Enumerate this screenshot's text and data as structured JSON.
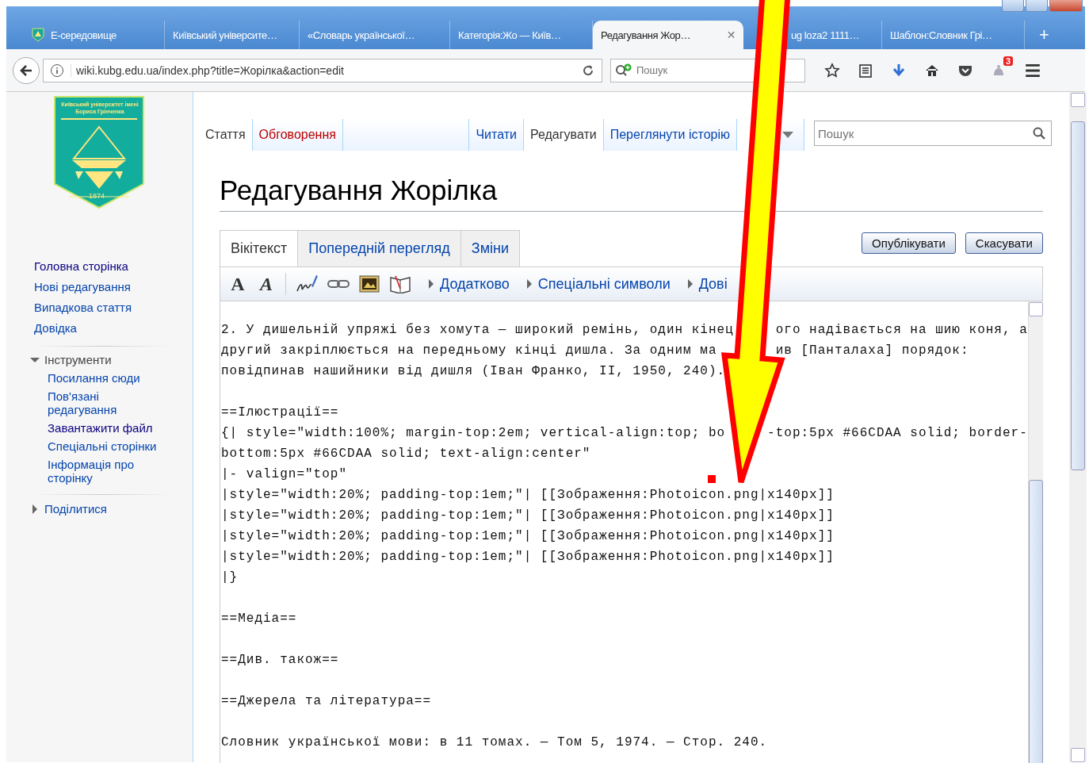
{
  "browser": {
    "tabs": [
      {
        "label": "Е-середовище",
        "selected": false
      },
      {
        "label": "Київський університе…",
        "selected": false
      },
      {
        "label": "«Словарь української…",
        "selected": false
      },
      {
        "label": "Категорія:Жо — Київ…",
        "selected": false
      },
      {
        "label": "Редагування Жор…",
        "selected": true
      },
      {
        "label": "ug loza2 1111…",
        "selected": false
      },
      {
        "label": "Шаблон:Словник Грі…",
        "selected": false
      }
    ],
    "close_glyph": "✕",
    "new_tab": "+",
    "address": "wiki.kubg.edu.ua/index.php?title=Жорілка&action=edit",
    "search_placeholder": "Пошук",
    "notification_count": "3"
  },
  "wiki": {
    "logo": {
      "caption": "Київський університет імені Бориса Грінченка",
      "year": "1874"
    },
    "nav": [
      {
        "label": "Головна сторінка",
        "visited": true
      },
      {
        "label": "Нові редагування",
        "visited": false
      },
      {
        "label": "Випадкова стаття",
        "visited": false
      },
      {
        "label": "Довідка",
        "visited": false
      }
    ],
    "tools": {
      "title": "Інструменти",
      "expanded": true,
      "items": [
        {
          "label": "Посилання сюди",
          "visited": false
        },
        {
          "label": "Пов'язані редагування",
          "visited": false
        },
        {
          "label": "Завантажити файл",
          "visited": true
        },
        {
          "label": "Спеціальні сторінки",
          "visited": false
        },
        {
          "label": "Інформація про сторінку",
          "visited": false
        }
      ]
    },
    "share": {
      "title": "Поділитися",
      "expanded": false
    },
    "namespaces": [
      {
        "label": "Стаття",
        "selected": true,
        "missing": false
      },
      {
        "label": "Обговорення",
        "selected": false,
        "missing": true
      }
    ],
    "views": [
      {
        "label": "Читати",
        "selected": false
      },
      {
        "label": "Редагувати",
        "selected": true
      },
      {
        "label": "Переглянути історію",
        "selected": false
      }
    ],
    "search_placeholder": "Пошук",
    "heading": "Редагування Жорілка",
    "editor": {
      "tabs": [
        {
          "label": "Вікітекст",
          "selected": true
        },
        {
          "label": "Попередній перегляд",
          "selected": false
        },
        {
          "label": "Зміни",
          "selected": false
        }
      ],
      "buttons": [
        "Опублікувати",
        "Скасувати"
      ],
      "format_buttons": [
        {
          "kind": "bold",
          "glyph": "A"
        },
        {
          "kind": "italic",
          "glyph": "A"
        }
      ],
      "toolbar_groups": [
        "Додатково",
        "Спеціальні символи",
        "Дові"
      ],
      "blocks": [
        [
          [
            "2. У дишельній упряжі без хомута — широкий ремінь, один кінец",
            "ого надівається на шию коня, а"
          ],
          [
            "другий закріплюється на передньому кінці дишла. За одним ма",
            "ив [Панталаха] порядок:"
          ],
          [
            "повідпинав нашийники від дишля (Іван Франко, II, 1950, 240)."
          ]
        ],
        [
          [
            "==Ілюстрації=="
          ],
          [
            "{| style=\"width:100%; margin-top:2em; vertical-align:top; bo",
            "-top:5px #66CDAA solid; border-"
          ],
          [
            "bottom:5px #66CDAA solid; text-align:center\""
          ],
          [
            "|- valign=\"top\""
          ],
          [
            "|style=\"width:20%; padding-top:1em;\"| [[Зображення:Photoicon.png|x140px]]"
          ],
          [
            "|style=\"width:20%; padding-top:1em;\"| [[Зображення:Photoicon.png|x140px]]"
          ],
          [
            "|style=\"width:20%; padding-top:1em;\"| [[Зображення:Photoicon.png|x140px]]"
          ],
          [
            "|style=\"width:20%; padding-top:1em;\"| [[Зображення:Photoicon.png|x140px]]"
          ],
          [
            "|}"
          ]
        ],
        [
          [
            "==Медіа=="
          ]
        ],
        [
          [
            "==Див. також=="
          ]
        ],
        [
          [
            "==Джерела та література=="
          ]
        ],
        [
          [
            "Словник української мови: в 11 томах. — Том 5, 1974. — Стор. 240."
          ]
        ]
      ]
    }
  }
}
